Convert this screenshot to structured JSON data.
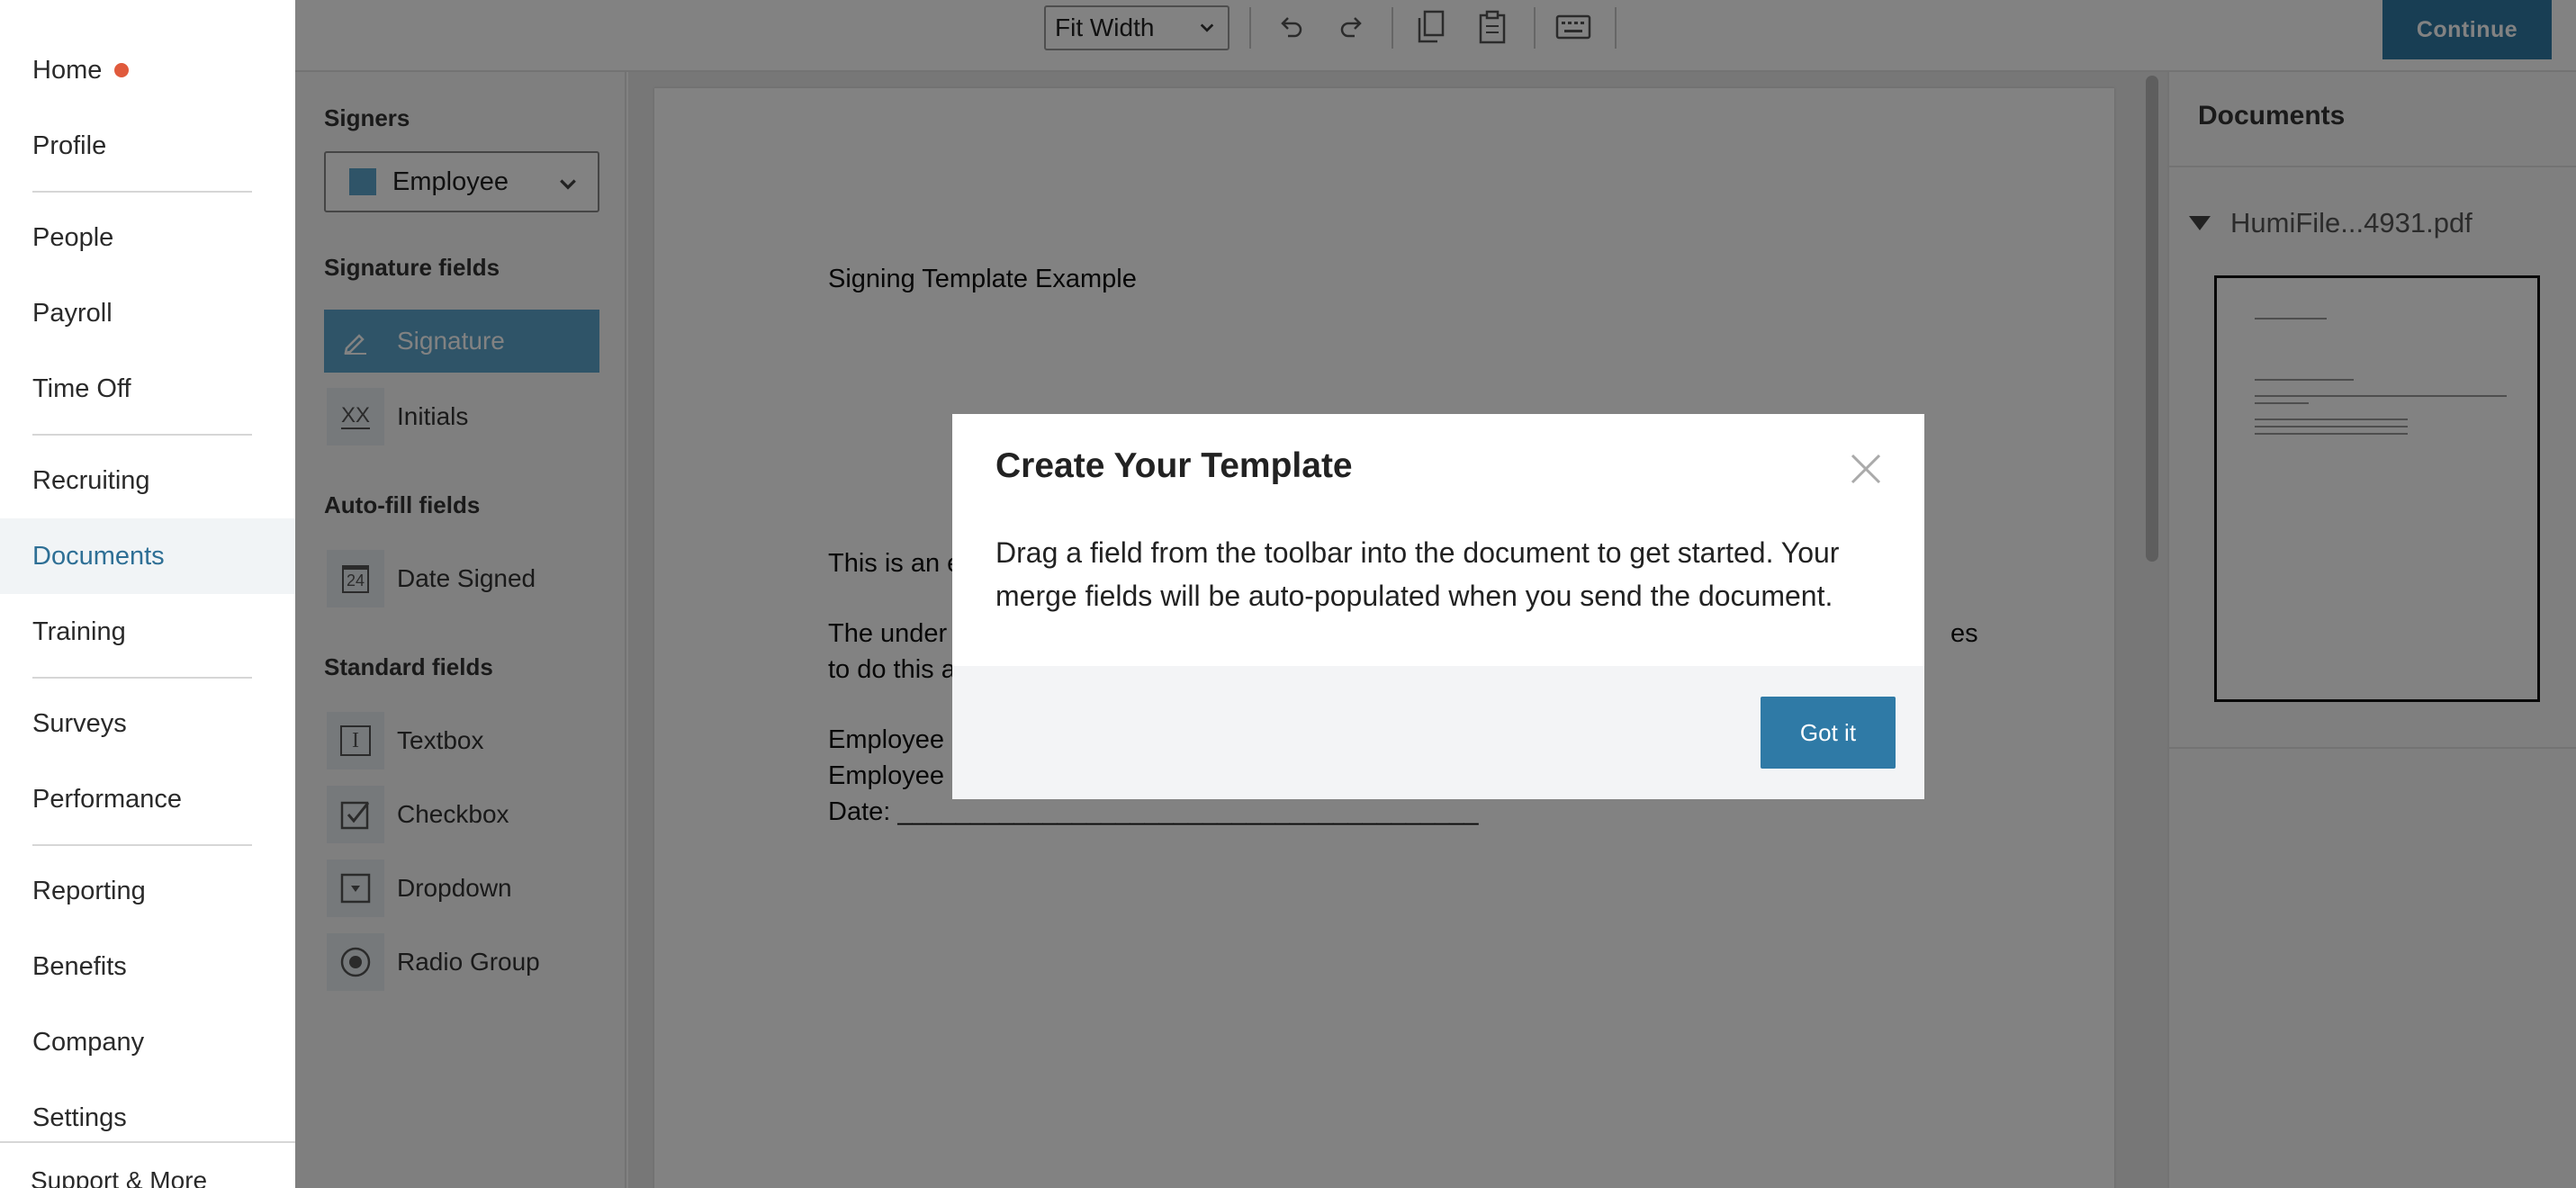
{
  "nav": {
    "items": [
      {
        "label": "Home"
      },
      {
        "label": "Profile"
      },
      {
        "label": "People"
      },
      {
        "label": "Payroll"
      },
      {
        "label": "Time Off"
      },
      {
        "label": "Recruiting"
      },
      {
        "label": "Documents"
      },
      {
        "label": "Training"
      },
      {
        "label": "Surveys"
      },
      {
        "label": "Performance"
      },
      {
        "label": "Reporting"
      },
      {
        "label": "Benefits"
      },
      {
        "label": "Company"
      },
      {
        "label": "Settings"
      }
    ],
    "support_label": "Support & More",
    "active_item": "Documents",
    "notification_color": "#e05a3c"
  },
  "toolbar": {
    "zoom_value": "Fit Width",
    "continue_label": "Continue"
  },
  "fields_panel": {
    "signers_heading": "Signers",
    "signer_selected": "Employee",
    "signer_color": "#5ca6cc",
    "signature_heading": "Signature fields",
    "signature_fields": [
      {
        "label": "Signature",
        "icon": "pen-icon"
      },
      {
        "label": "Initials",
        "icon": "initials-icon",
        "glyph": "XX"
      }
    ],
    "autofill_heading": "Auto-fill fields",
    "autofill_fields": [
      {
        "label": "Date Signed",
        "icon": "calendar-icon",
        "glyph": "24"
      }
    ],
    "standard_heading": "Standard fields",
    "standard_fields": [
      {
        "label": "Textbox",
        "icon": "textbox-icon",
        "glyph": "I"
      },
      {
        "label": "Checkbox",
        "icon": "checkbox-icon"
      },
      {
        "label": "Dropdown",
        "icon": "dropdown-icon"
      },
      {
        "label": "Radio Group",
        "icon": "radio-icon"
      }
    ]
  },
  "document": {
    "title": "Signing Template Example",
    "line_intro": "This is an e",
    "line_under": "The under",
    "line_under_tail": "es",
    "line_todo": "to do this a",
    "line_emp1": "Employee",
    "line_emp2": "Employee",
    "line_date": "Date: ________________________________________"
  },
  "docs_panel": {
    "heading": "Documents",
    "file_name": "HumiFile...4931.pdf"
  },
  "modal": {
    "title": "Create Your Template",
    "body": "Drag a field from the toolbar into the document to get started. Your merge fields will be auto-populated when you send the document.",
    "button_label": "Got it"
  },
  "colors": {
    "accent": "#2f7aa6",
    "selected_field": "#5ca6cc",
    "overlay": "rgba(0,0,0,0.49)"
  }
}
